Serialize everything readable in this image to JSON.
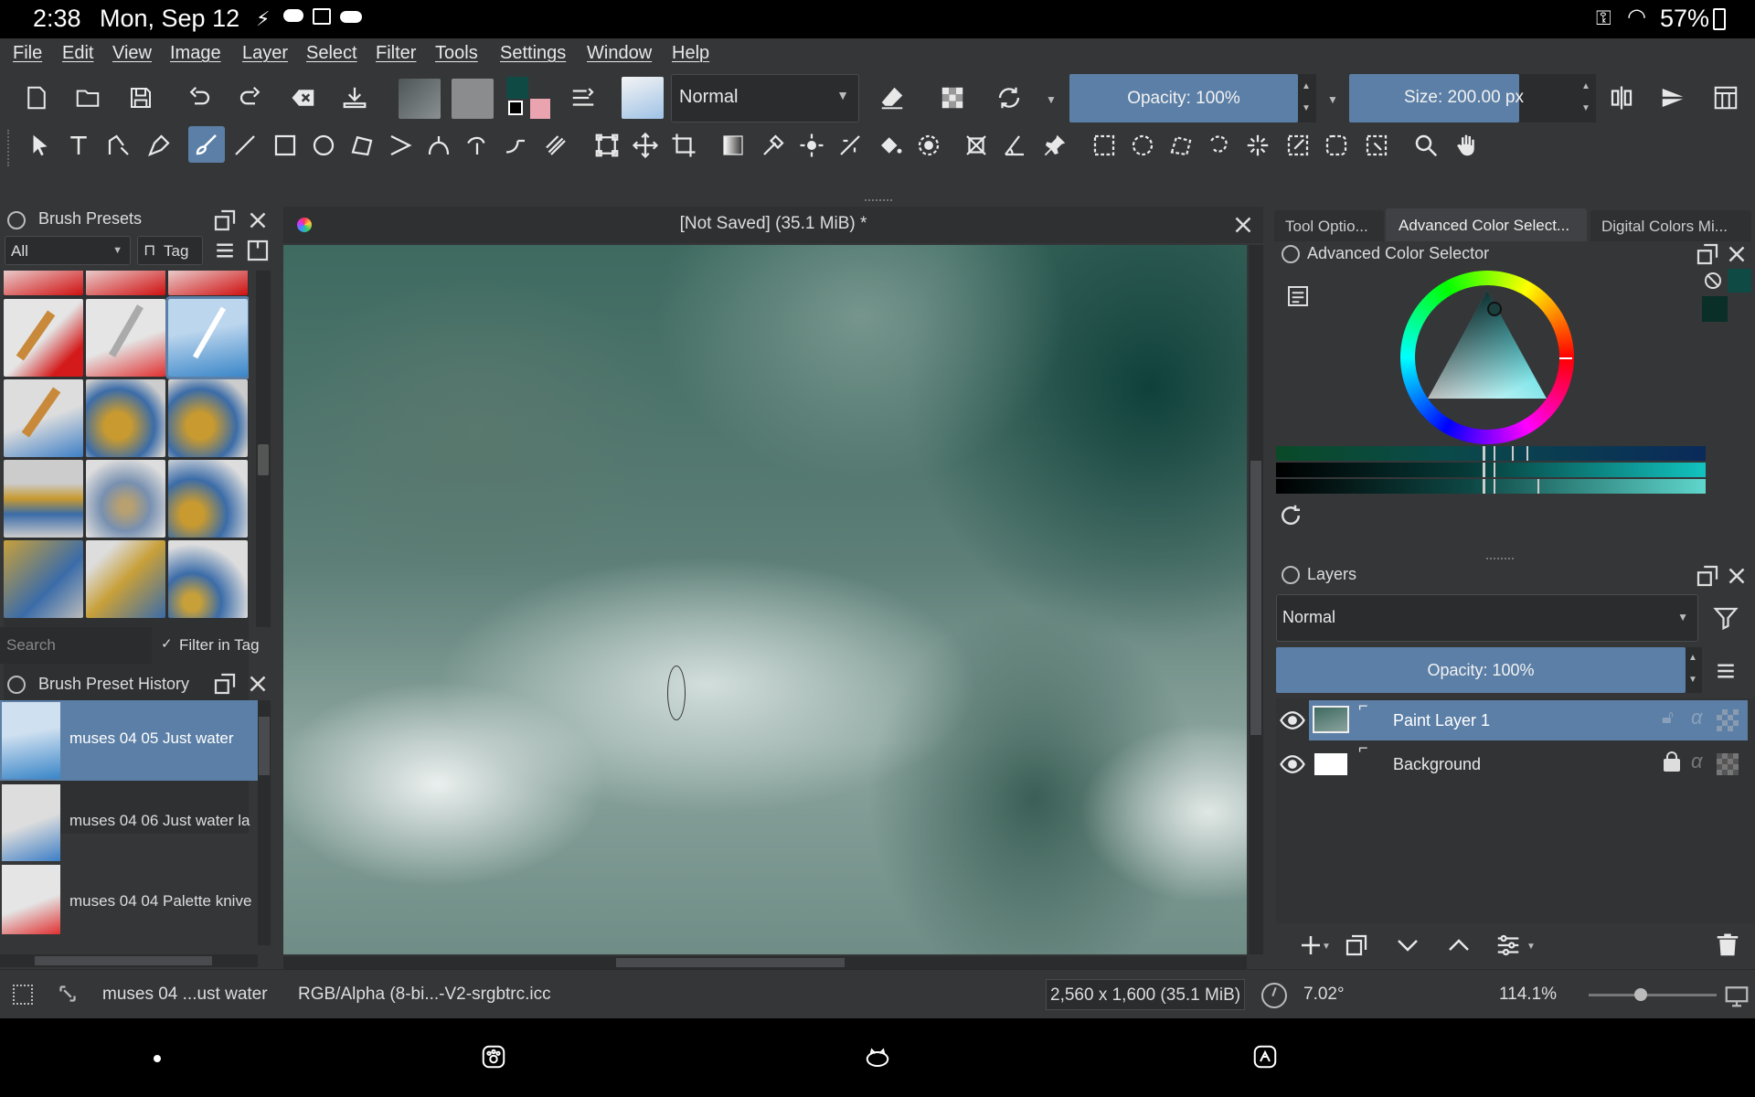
{
  "system": {
    "time": "2:38",
    "date": "Mon, Sep 12",
    "battery": "57%"
  },
  "menu": [
    "File",
    "Edit",
    "View",
    "Image",
    "Layer",
    "Select",
    "Filter",
    "Tools",
    "Settings",
    "Window",
    "Help"
  ],
  "toolbar": {
    "blend_mode": "Normal",
    "opacity": "Opacity: 100%",
    "size": "Size: 200.00 px"
  },
  "brush_presets": {
    "title": "Brush Presets",
    "filter_value": "All",
    "tag_label": "Tag",
    "search_placeholder": "Search",
    "filter_in_tag": "Filter in Tag"
  },
  "history": {
    "title": "Brush Preset History",
    "items": [
      {
        "label": "muses 04 05 Just water"
      },
      {
        "label": "muses 04 06 Just water la"
      },
      {
        "label": "muses 04 04 Palette knive"
      }
    ]
  },
  "canvas": {
    "title": "[Not Saved]  (35.1 MiB)  *"
  },
  "right_tabs": [
    "Tool Optio...",
    "Advanced Color Select...",
    "Digital Colors Mi..."
  ],
  "color_selector": {
    "title": "Advanced Color Selector",
    "fg_color": "#0f4a44",
    "bg_color": "#0a2e28"
  },
  "layers": {
    "title": "Layers",
    "blend_mode": "Normal",
    "opacity": "Opacity:  100%",
    "items": [
      {
        "name": "Paint Layer 1"
      },
      {
        "name": "Background"
      }
    ]
  },
  "statusbar": {
    "brush": "muses 04 ...ust water",
    "colorspace": "RGB/Alpha (8-bi...-V2-srgbtrc.icc",
    "dimensions": "2,560 x 1,600 (35.1 MiB)",
    "rotation": "7.02°",
    "zoom": "114.1%"
  }
}
